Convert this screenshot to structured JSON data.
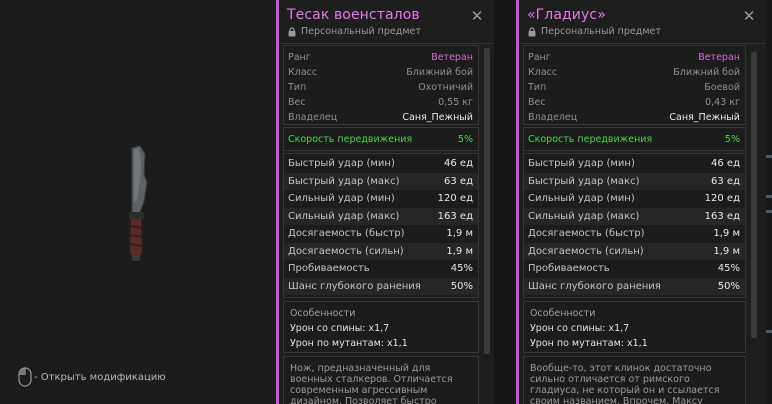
{
  "hint": {
    "text": "- Открыть модификацию",
    "icon": "mouse-icon"
  },
  "cards": [
    {
      "title": "Тесак военсталов",
      "subtitle": "Персональный предмет",
      "info": [
        {
          "k": "Ранг",
          "v": "Ветеран",
          "style": "accent"
        },
        {
          "k": "Класс",
          "v": "Ближний бой",
          "style": ""
        },
        {
          "k": "Тип",
          "v": "Охотничий",
          "style": ""
        },
        {
          "k": "Вес",
          "v": "0,55 кг",
          "style": ""
        },
        {
          "k": "Владелец",
          "v": "Саня_Пежный",
          "style": "white"
        }
      ],
      "speed": {
        "k": "Скорость передвижения",
        "v": "5%"
      },
      "stats": [
        {
          "k": "Быстрый удар (мин)",
          "v": "46 ед"
        },
        {
          "k": "Быстрый удар (макс)",
          "v": "63 ед"
        },
        {
          "k": "Сильный удар (мин)",
          "v": "120 ед"
        },
        {
          "k": "Сильный удар (макс)",
          "v": "163 ед"
        },
        {
          "k": "Досягаемость (быстр)",
          "v": "1,9 м"
        },
        {
          "k": "Досягаемость (сильн)",
          "v": "1,9 м"
        },
        {
          "k": "Пробиваемость",
          "v": "45%"
        },
        {
          "k": "Шанс глубокого ранения",
          "v": "50%"
        }
      ],
      "features": {
        "title": "Особенности",
        "lines": [
          "Урон со спины: x1,7",
          "Урон по мутантам: x1,1"
        ]
      },
      "description": "Нож, предназначенный для военных сталкеров. Отличается современным агрессивным дизайном. Позволяет быстро наносить мощные"
    },
    {
      "title": "«Гладиус»",
      "subtitle": "Персональный предмет",
      "info": [
        {
          "k": "Ранг",
          "v": "Ветеран",
          "style": "accent"
        },
        {
          "k": "Класс",
          "v": "Ближний бой",
          "style": ""
        },
        {
          "k": "Тип",
          "v": "Боевой",
          "style": ""
        },
        {
          "k": "Вес",
          "v": "0,43 кг",
          "style": ""
        },
        {
          "k": "Владелец",
          "v": "Саня_Пежный",
          "style": "white"
        }
      ],
      "speed": {
        "k": "Скорость передвижения",
        "v": "5%"
      },
      "stats": [
        {
          "k": "Быстрый удар (мин)",
          "v": "46 ед"
        },
        {
          "k": "Быстрый удар (макс)",
          "v": "63 ед"
        },
        {
          "k": "Сильный удар (мин)",
          "v": "120 ед"
        },
        {
          "k": "Сильный удар (макс)",
          "v": "163 ед"
        },
        {
          "k": "Досягаемость (быстр)",
          "v": "1,9 м"
        },
        {
          "k": "Досягаемость (сильн)",
          "v": "1,9 м"
        },
        {
          "k": "Пробиваемость",
          "v": "45%"
        },
        {
          "k": "Шанс глубокого ранения",
          "v": "50%"
        }
      ],
      "features": {
        "title": "Особенности",
        "lines": [
          "Урон со спины: x1,7",
          "Урон по мутантам: x1,1"
        ]
      },
      "description": "Вообще-то, этот клинок достаточно сильно отличается от римского гладиуса, не который он и ссылается своим названием. Впрочем, Максу Ворону это"
    }
  ],
  "colors": {
    "accent": "#c05ad4",
    "title": "#e57be9",
    "speed": "#4fd04f"
  }
}
